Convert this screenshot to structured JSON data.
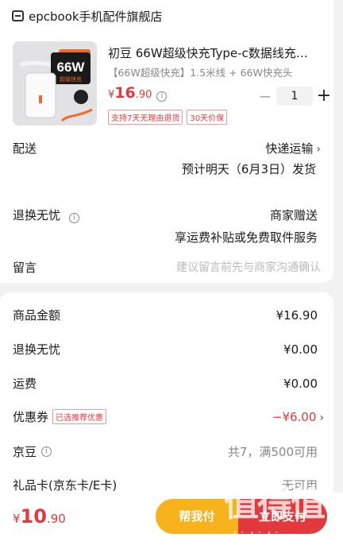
{
  "store": {
    "name": "epcbook手机配件旗舰店",
    "icon": "store-icon"
  },
  "product": {
    "image_text": "66W",
    "image_subtext": "超级快充",
    "title": "初豆 66W超级快充Type-c数据线充…",
    "spec": "【66W超级快充】1.5米线 + 66W快充头",
    "price_yen": "¥",
    "price_int": "16",
    "price_dec": ".90",
    "info_icon": "i",
    "quantity": "1",
    "minus": "−",
    "plus": "+",
    "tags": [
      "支持7天无理由退货",
      "30天价保"
    ]
  },
  "delivery": {
    "label": "配送",
    "method": "快递运输",
    "chevron": "›",
    "eta": "预计明天（6月3日）发货"
  },
  "returns": {
    "label": "退换无忧",
    "info_icon": "i",
    "value": "商家赠送",
    "detail": "享运费补贴或免费取件服务"
  },
  "message": {
    "label": "留言",
    "placeholder": "建议留言前先与商家沟通确认"
  },
  "order": {
    "goods_label": "商品金额",
    "goods_value": "¥16.90",
    "returns_label": "退换无忧",
    "returns_value": "¥0.00",
    "shipping_label": "运费",
    "shipping_value": "¥0.00",
    "coupon_label": "优惠券",
    "coupon_tag": "已选推荐优惠",
    "coupon_value": "−¥6.00",
    "chevron": "›",
    "jingdou_label": "京豆",
    "jingdou_info_icon": "i",
    "jingdou_value": "共7，满500可用",
    "giftcard_label": "礼品卡(京东卡/E卡)",
    "giftcard_value": "无可用"
  },
  "footer": {
    "total_yen": "¥",
    "total_int": "10",
    "total_dec": ".90",
    "help_pay": "帮我付",
    "pay": "立即支付"
  },
  "watermark": {
    "logo": "值得值",
    "text": "zhizhizhi.com"
  },
  "colors": {
    "accent": "#e4393c",
    "help": "#f7b21c"
  }
}
